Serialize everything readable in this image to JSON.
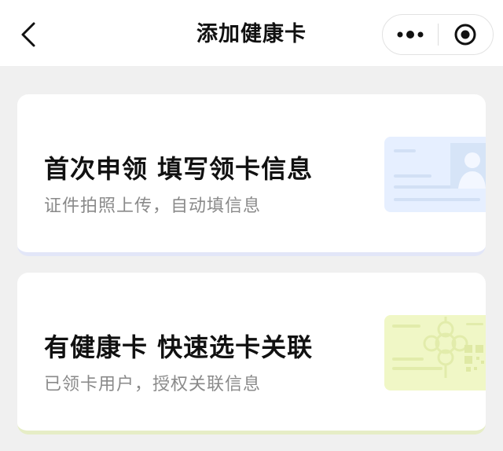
{
  "navbar": {
    "title": "添加健康卡",
    "back_icon": "chevron-left-icon",
    "more_icon": "more-dots-icon",
    "close_icon": "record-close-icon"
  },
  "cards": [
    {
      "title": "首次申领  填写领卡信息",
      "subtitle": "证件拍照上传，自动填信息",
      "art_icon": "id-card-icon",
      "accent": "#e2e6f8"
    },
    {
      "title": "有健康卡  快速选卡关联",
      "subtitle": "已领卡用户，授权关联信息",
      "art_icon": "health-card-icon",
      "accent": "#e6edc6"
    }
  ],
  "colors": {
    "background": "#f0f0f0",
    "card_background": "#ffffff",
    "title_text": "#111111",
    "subtitle_text": "#8a8a8a"
  }
}
